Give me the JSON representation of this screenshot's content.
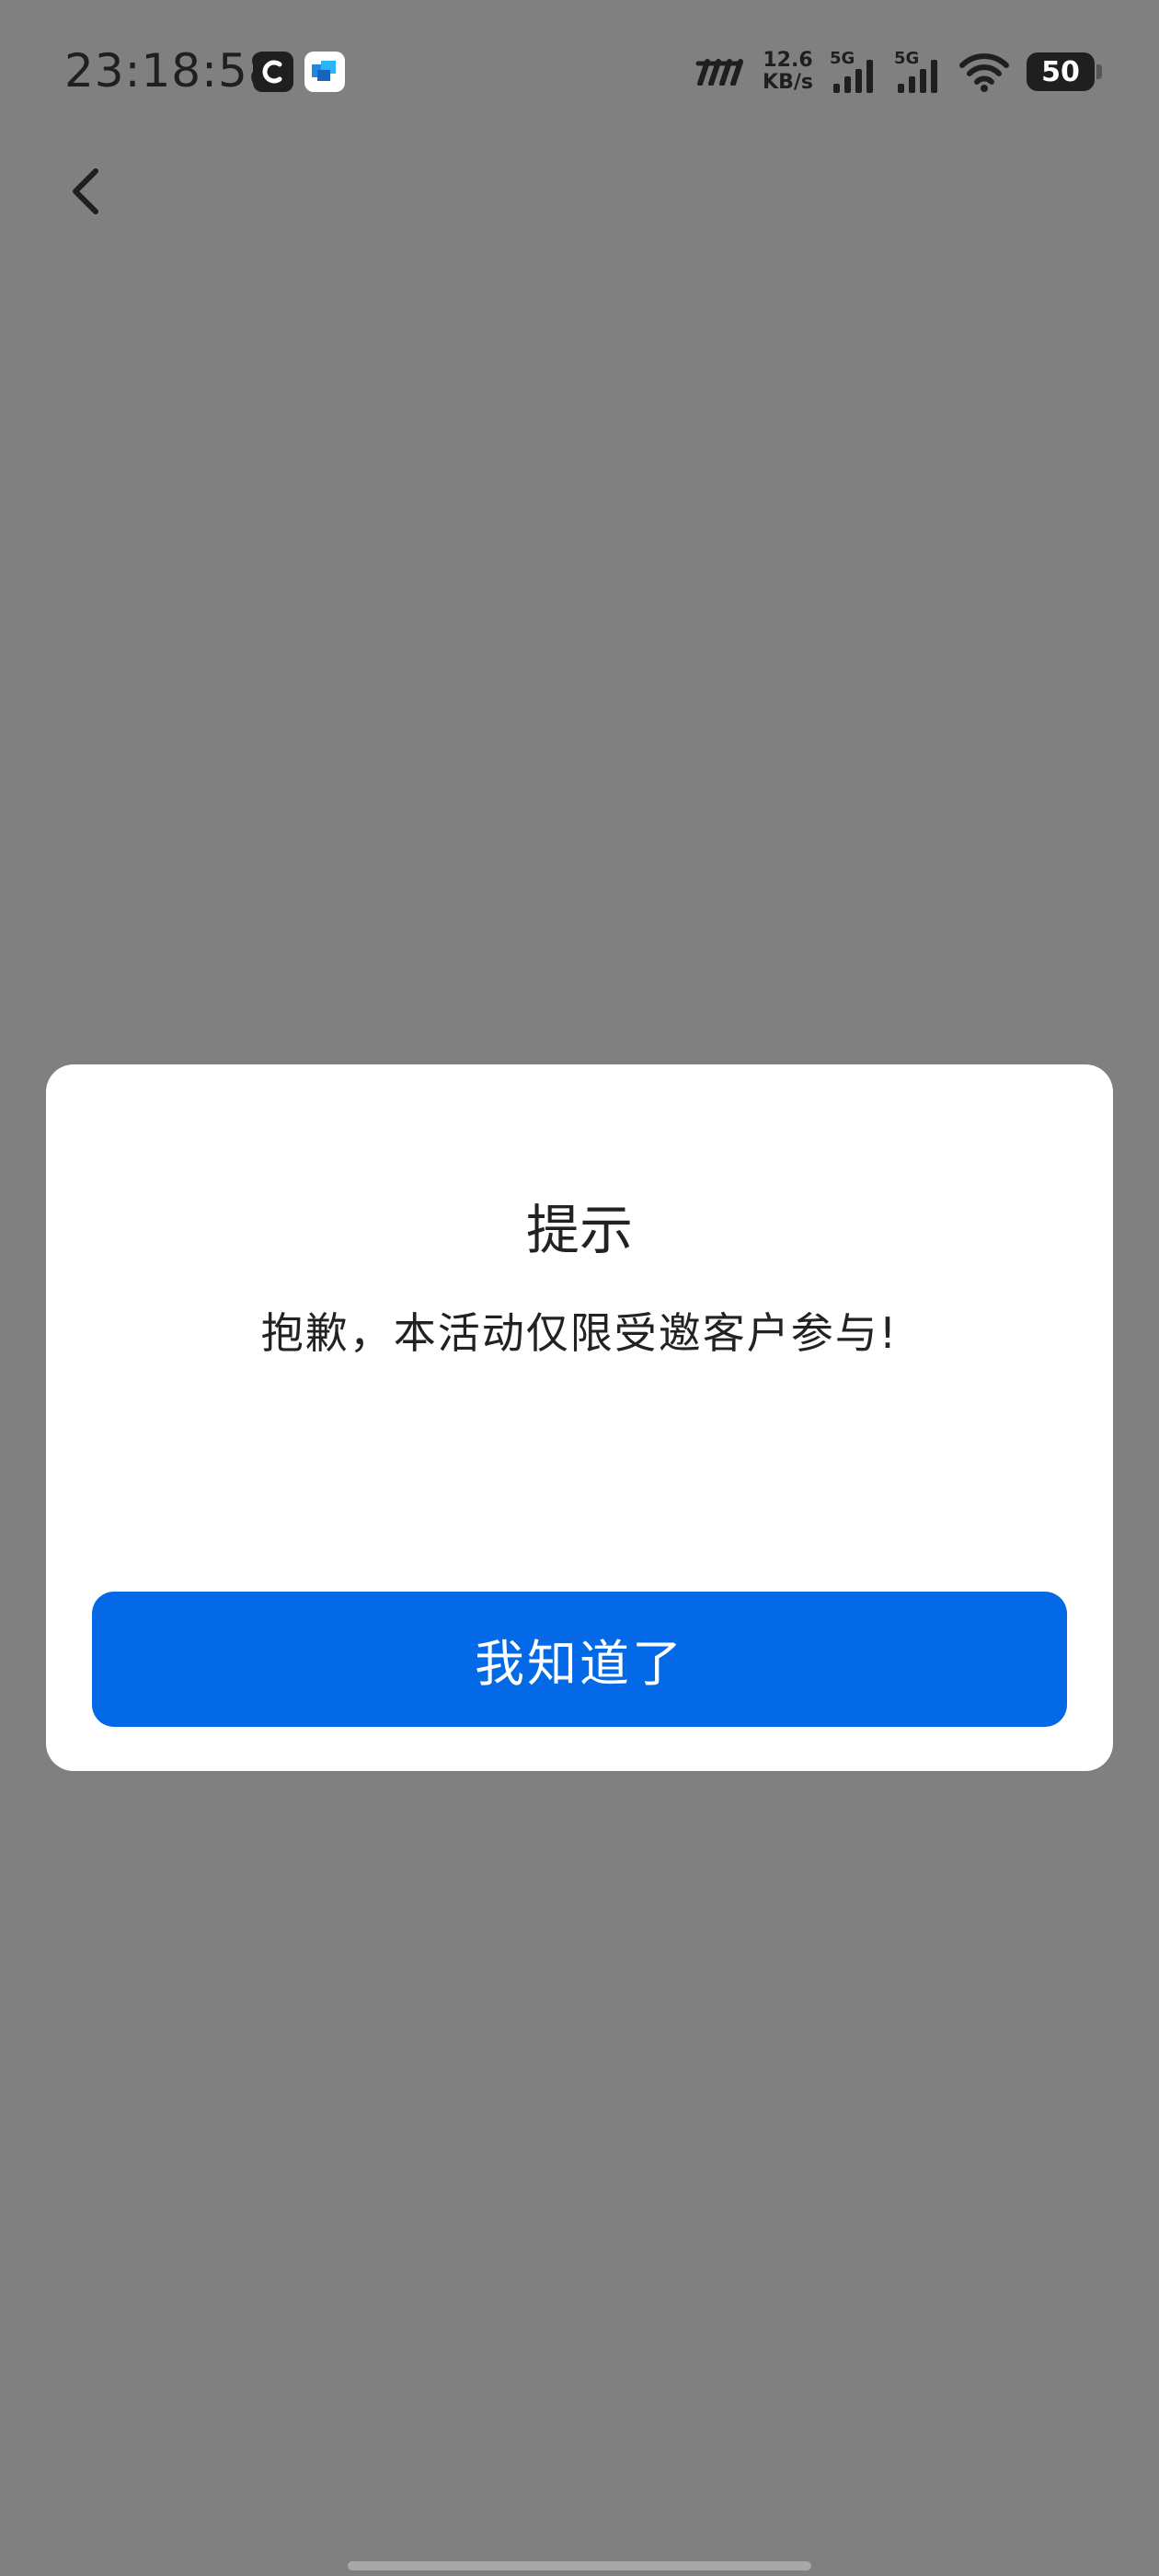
{
  "status_bar": {
    "time": "23:18:58",
    "net_speed_value": "12.6",
    "net_speed_unit": "KB/s",
    "signal_1_label": "5G",
    "signal_2_label": "5G",
    "battery_level": "50"
  },
  "header": {
    "back_icon": "chevron-left-icon"
  },
  "dialog": {
    "title": "提示",
    "message": "抱歉，本活动仅限受邀客户参与!",
    "confirm_label": "我知道了",
    "confirm_color": "#0369e6"
  },
  "colors": {
    "overlay": "#808080",
    "dialog_background": "#ffffff",
    "text": "#222222"
  }
}
